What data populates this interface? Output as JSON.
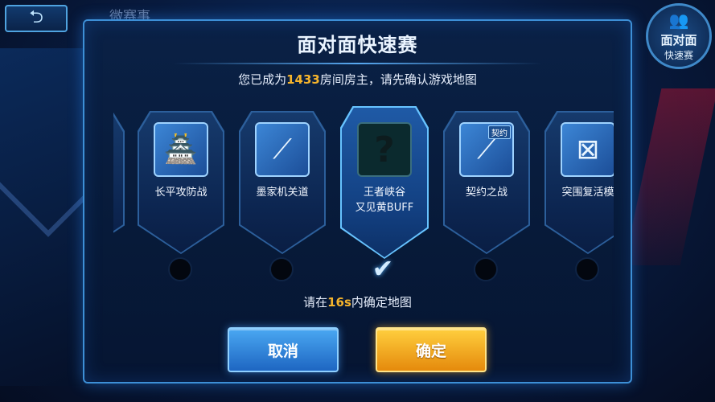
{
  "top": {
    "back_symbol": "⮌",
    "background_text": "微赛事",
    "badge_line1": "面对面",
    "badge_line2": "快速赛",
    "badge_icon": "people-icon"
  },
  "dialog": {
    "title": "面对面快速赛",
    "subtitle_prefix": "您已成为",
    "room_number": "1433",
    "subtitle_suffix": "房间房主，请先确认游戏地图",
    "maps": [
      {
        "name": "长平攻防战",
        "icon": "fortress-icon"
      },
      {
        "name": "墨家机关道",
        "icon": "mechanism-road-icon"
      },
      {
        "name": "王者峡谷",
        "name2": "又见黄BUFF",
        "icon": "question-mark-icon",
        "selected": true
      },
      {
        "name": "契约之战",
        "icon": "contract-icon",
        "tag": "契约"
      },
      {
        "name": "突围复活模",
        "icon": "breakout-icon"
      }
    ],
    "timer_prefix": "请在",
    "timer_value": "16s",
    "timer_suffix": "内确定地图",
    "cancel_label": "取消",
    "confirm_label": "确定"
  },
  "colors": {
    "accent_blue": "#3d8fd6",
    "highlight_orange": "#f5b42c",
    "confirm_gold": "#ffcf3e"
  }
}
